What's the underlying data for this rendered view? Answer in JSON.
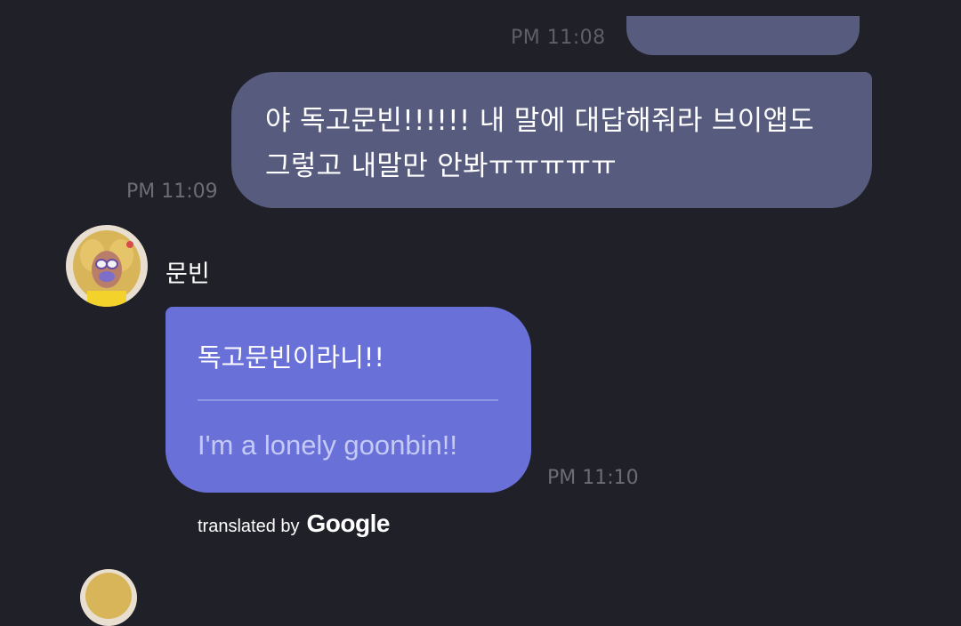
{
  "previous_message": {
    "time": "PM 11:08"
  },
  "outgoing_message": {
    "line1": "야 독고문빈!!!!!! 내 말에 대답해줘라 브이앱도",
    "line2": "그렇고 내말만 안봐ㅠㅠㅠㅠㅠ",
    "time": "PM 11:09"
  },
  "incoming_message": {
    "sender_name": "문빈",
    "text": "독고문빈이라니!!",
    "translation": "I'm a lonely goonbin!!",
    "time": "PM 11:10"
  },
  "translation_credit": {
    "prefix": "translated by",
    "brand": "Google"
  },
  "colors": {
    "background": "#202028",
    "outgoing_bubble": "#575b7d",
    "incoming_bubble": "#6971d8",
    "timestamp": "#6c6c76"
  }
}
